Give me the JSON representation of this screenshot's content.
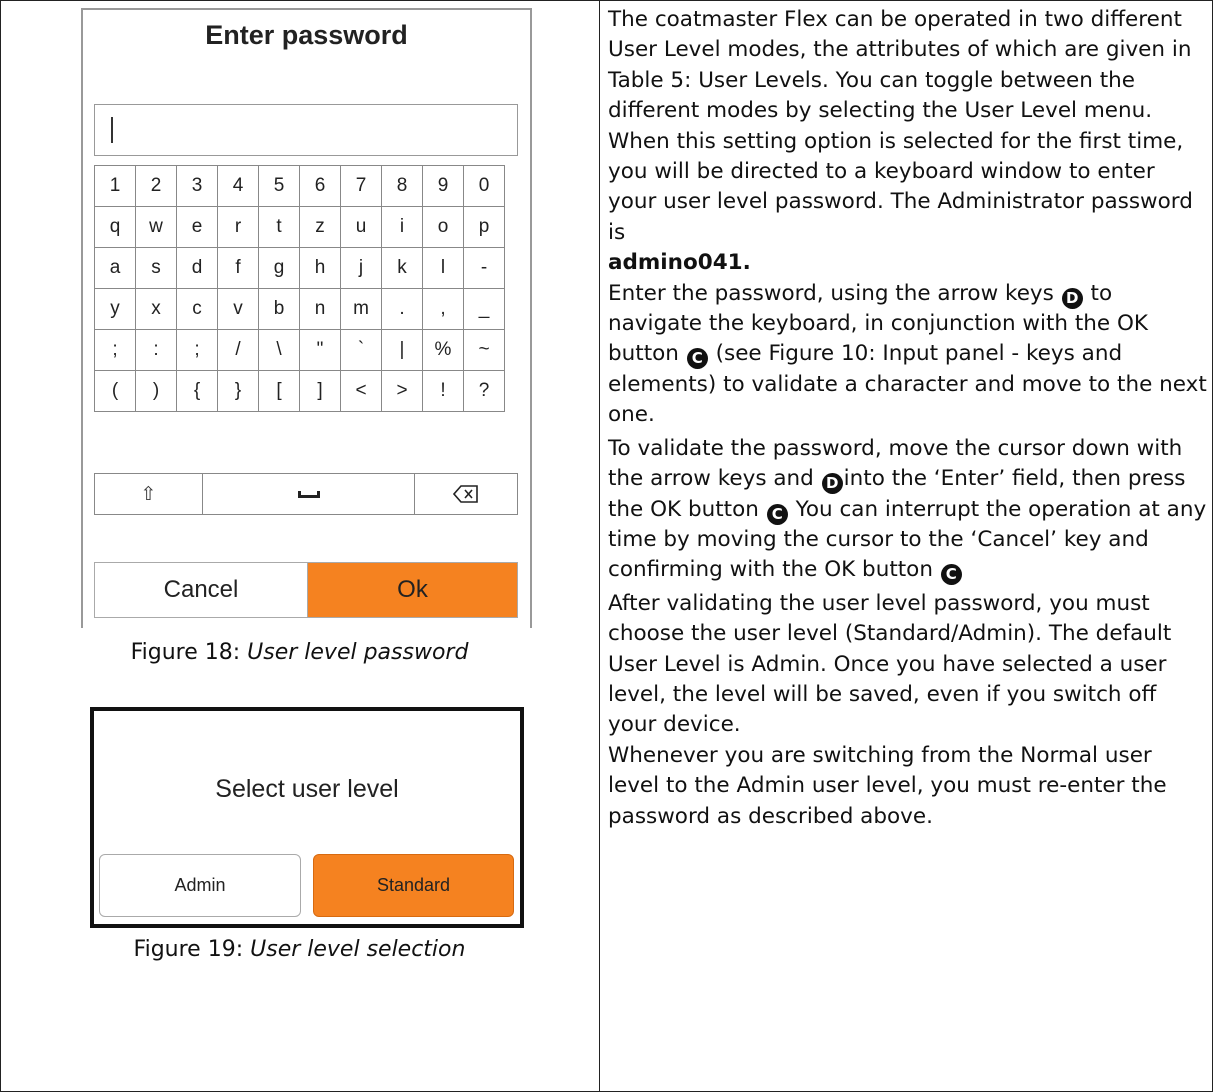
{
  "password_dialog": {
    "title": "Enter password",
    "input_value": "",
    "keyboard_rows": [
      [
        "1",
        "2",
        "3",
        "4",
        "5",
        "6",
        "7",
        "8",
        "9",
        "0"
      ],
      [
        "q",
        "w",
        "e",
        "r",
        "t",
        "z",
        "u",
        "i",
        "o",
        "p"
      ],
      [
        "a",
        "s",
        "d",
        "f",
        "g",
        "h",
        "j",
        "k",
        "l",
        "-"
      ],
      [
        "y",
        "x",
        "c",
        "v",
        "b",
        "n",
        "m",
        ".",
        ",",
        "_"
      ],
      [
        ";",
        ":",
        ";",
        "/",
        "\\",
        "\"",
        "`",
        "|",
        "%",
        "~"
      ],
      [
        "(",
        ")",
        "{",
        "}",
        "[",
        "]",
        "<",
        ">",
        "!",
        "?"
      ]
    ],
    "shift_key": "⇧",
    "space_icon": "space-icon",
    "backspace_icon": "backspace-icon",
    "cancel_label": "Cancel",
    "ok_label": "Ok"
  },
  "figure18": {
    "prefix": "Figure 18: ",
    "title": "User level password"
  },
  "user_level_dialog": {
    "title": "Select user level",
    "admin_label": "Admin",
    "standard_label": "Standard"
  },
  "figure19": {
    "prefix": "Figure 19: ",
    "title": "User level selection"
  },
  "accent_color": "#f58220",
  "text": {
    "p1": "The coatmaster Flex can be operated in two different User Level modes, the attributes of which are given in Table 5: User Levels. You can toggle between the different modes by selecting the User Level menu. When this setting option is selected for the first time, you will be directed to a keyboard window to enter your user level password. The Administrator password is",
    "p1_password": "admino041.",
    "p2_a": "Enter the password, using the arrow keys",
    "p2_b": "to navigate the keyboard, in conjunction with the OK button",
    "p2_c": "(see Figure 10: Input panel - keys and elements) to validate a character and move to the next one.",
    "p3_a": "To validate the password, move the cursor down with the arrow keys and",
    "p3_b": "into the ‘Enter’ field, then press the OK button",
    "p3_c": "You can interrupt the operation at any time by moving the cursor to the ‘Cancel’ key and confirming with the OK button",
    "p4": "After validating the user level password, you must choose the user level (Standard/Admin). The default User Level is Admin. Once you have selected a user level, the level will be saved, even if you switch off your device.",
    "p5": "Whenever you are switching from the Normal user level to the Admin user level, you must re-enter the password as described above.",
    "symbol_d": "D",
    "symbol_c": "C"
  }
}
